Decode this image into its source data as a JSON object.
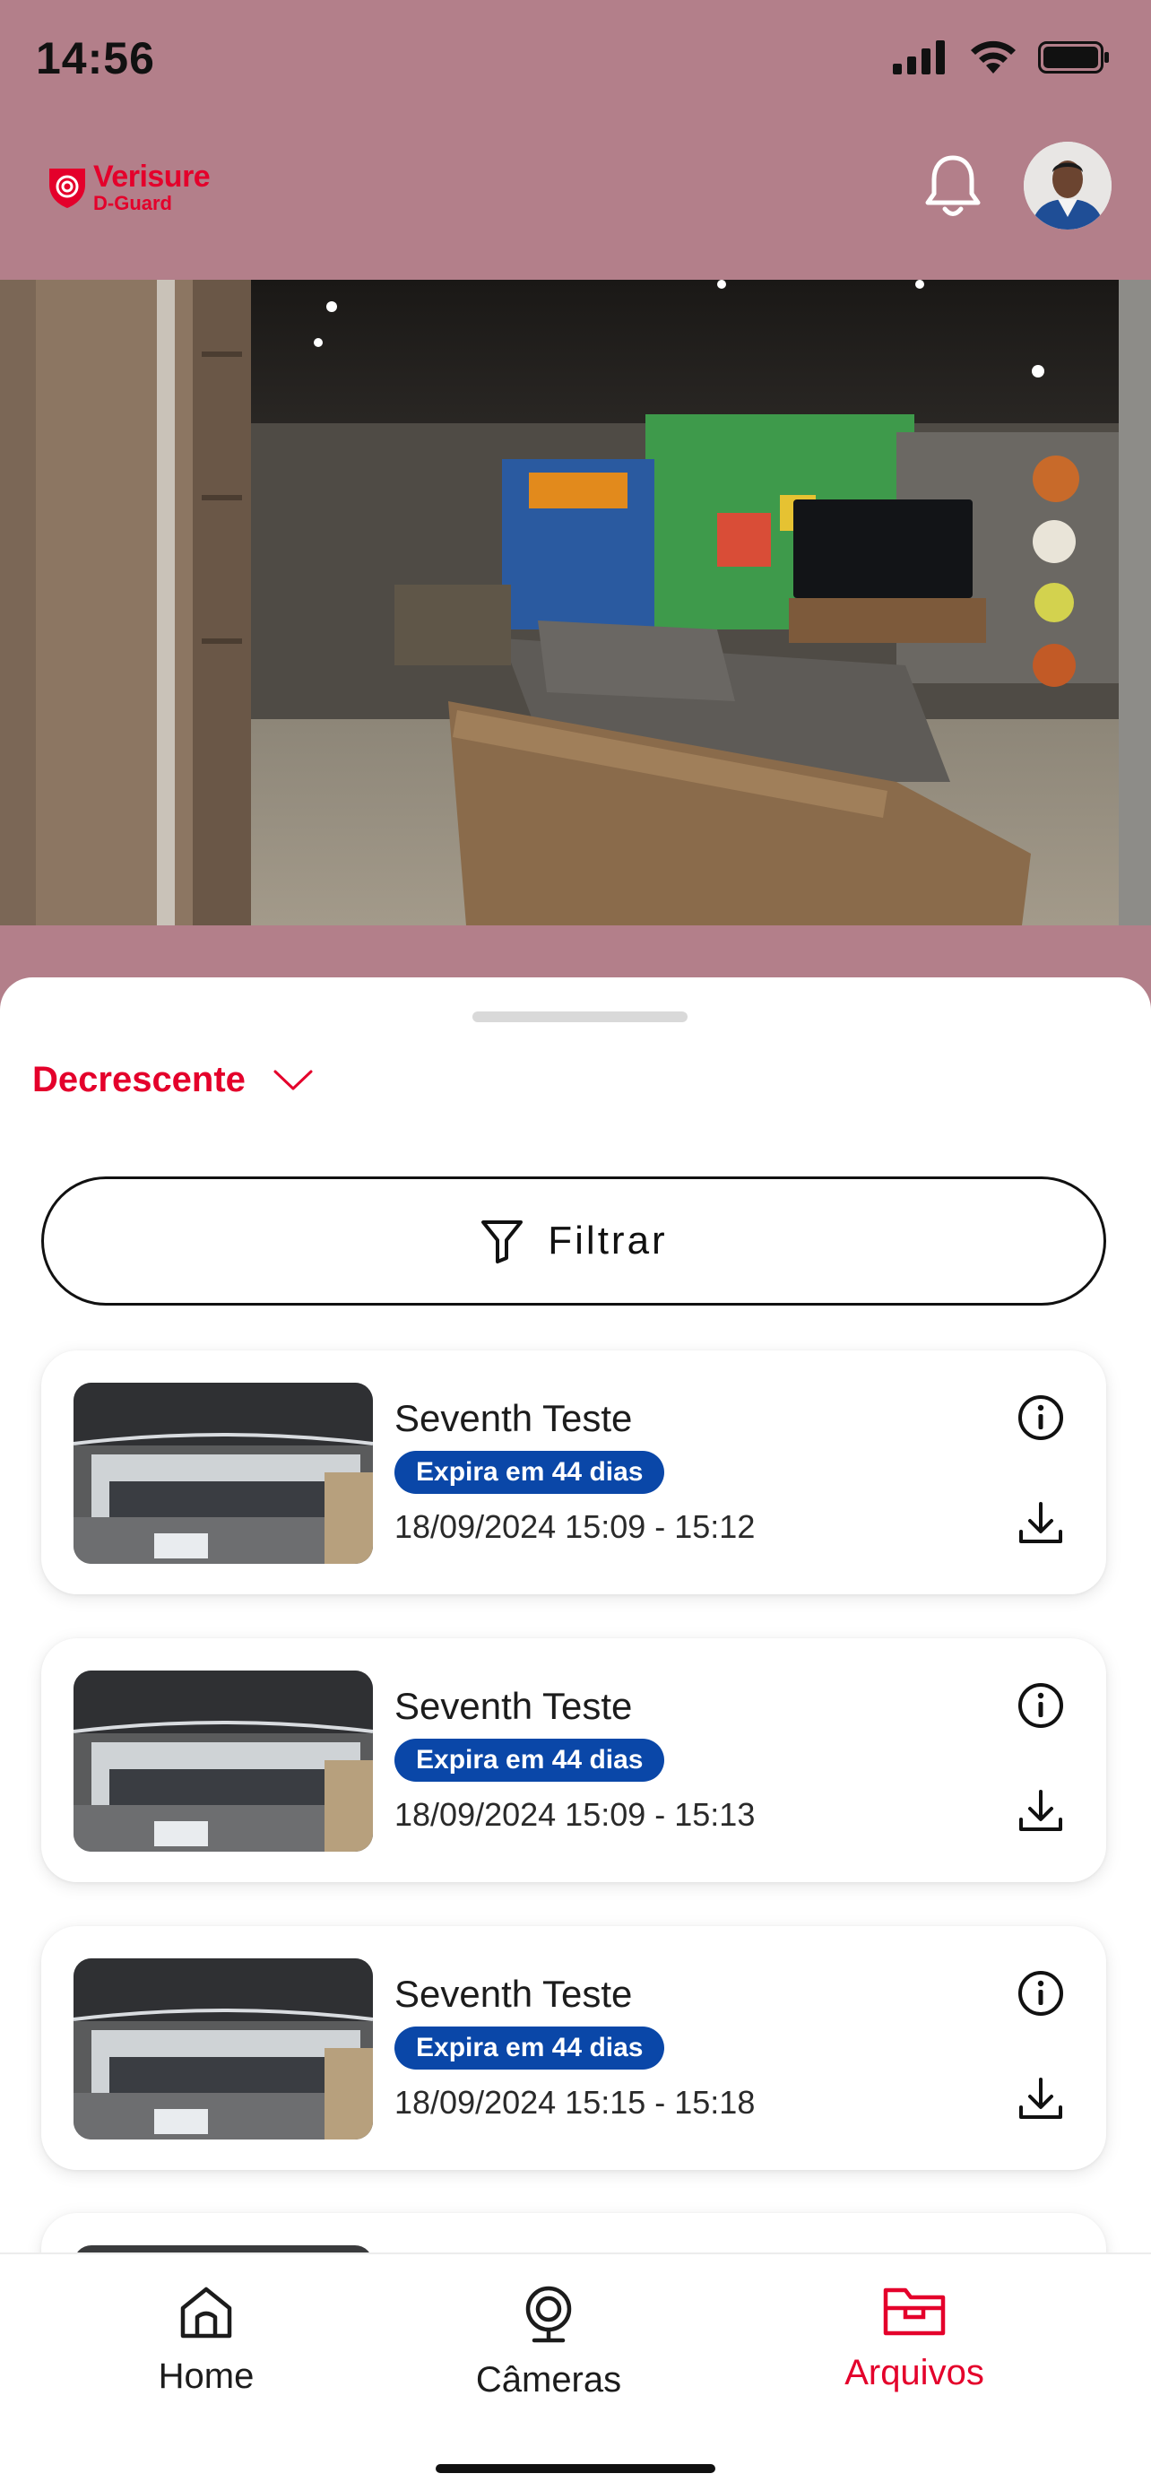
{
  "status_bar": {
    "time": "14:56"
  },
  "header": {
    "logo_line1": "Verisure",
    "logo_line2": "D-Guard",
    "bell_icon": "bell-icon",
    "avatar_icon": "user-avatar"
  },
  "sort": {
    "label": "Decrescente",
    "icon": "chevron-down-icon"
  },
  "filter": {
    "label": "Filtrar",
    "icon": "filter-icon"
  },
  "recordings": [
    {
      "title": "Seventh Teste",
      "badge": "Expira em 44 dias",
      "time": "18/09/2024 15:09 -  15:12"
    },
    {
      "title": "Seventh Teste",
      "badge": "Expira em 44 dias",
      "time": "18/09/2024 15:09 -  15:13"
    },
    {
      "title": "Seventh Teste",
      "badge": "Expira em 44 dias",
      "time": "18/09/2024 15:15 -  15:18"
    }
  ],
  "tabs": [
    {
      "label": "Home",
      "icon": "home-icon",
      "active": false
    },
    {
      "label": "Câmeras",
      "icon": "camera-icon",
      "active": false
    },
    {
      "label": "Arquivos",
      "icon": "folder-icon",
      "active": true
    }
  ],
  "colors": {
    "accent": "#e4002b",
    "header_bg": "#b37f8a",
    "badge_bg": "#0a47a8"
  }
}
